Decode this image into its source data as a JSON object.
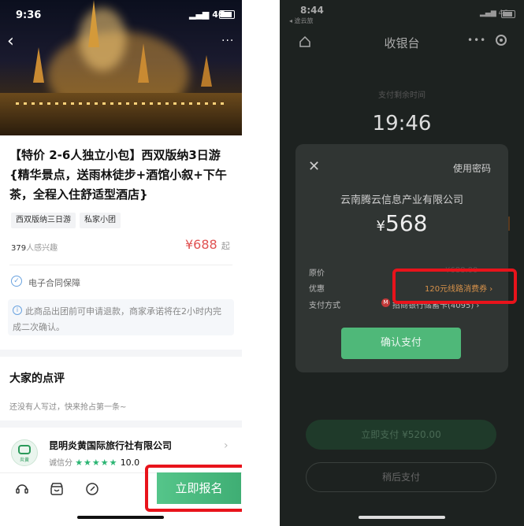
{
  "colors": {
    "accent_green": "#4ab87a",
    "price_red": "#e05252",
    "highlight_red": "#e8131b",
    "coupon_orange": "#d8924a",
    "star_green": "#2bb573"
  },
  "left": {
    "status": {
      "time": "9:36",
      "network": "4G"
    },
    "product_title": "【特价 2-6人独立小包】西双版纳3日游{精华景点，送雨林徒步+酒馆小叙+下午茶，全程入住舒适型酒店}",
    "tags": [
      "西双版纳三日游",
      "私家小团"
    ],
    "interest": {
      "count": "379",
      "suffix": "人感兴趣"
    },
    "price": {
      "amount": "¥688",
      "suffix": "起"
    },
    "contract_text": "电子合同保障",
    "notice_text": "此商品出团前可申请退款，商家承诺将在2小时内完成二次确认。",
    "reviews": {
      "title": "大家的点评",
      "empty_text": "还没有人写过，快来抢占第一条~"
    },
    "merchant": {
      "name": "昆明炎黄国际旅行社有限公司",
      "score_label": "诚信分",
      "score": "10.0",
      "stars": 5,
      "logo_text": "炎黄"
    },
    "signup_button": "立即报名"
  },
  "right": {
    "status": {
      "time": "8:44",
      "back_label": "◂ 途云旅",
      "network": "4G"
    },
    "nav_title": "收银台",
    "countdown_label": "支付剩余时间",
    "countdown": "19:46",
    "dialog": {
      "password_link": "使用密码",
      "company": "云南腾云信息产业有限公司",
      "currency": "¥",
      "amount": "568",
      "rows": [
        {
          "label": "原价",
          "value": "¥688.00"
        },
        {
          "label": "优惠",
          "value": "120元线路消费券 ›"
        },
        {
          "label": "支付方式",
          "value": "招商银行储蓄卡(4095) ›"
        }
      ],
      "confirm_button": "确认支付"
    },
    "pay_now_button": "立即支付 ¥520.00",
    "pay_later_button": "稍后支付"
  }
}
